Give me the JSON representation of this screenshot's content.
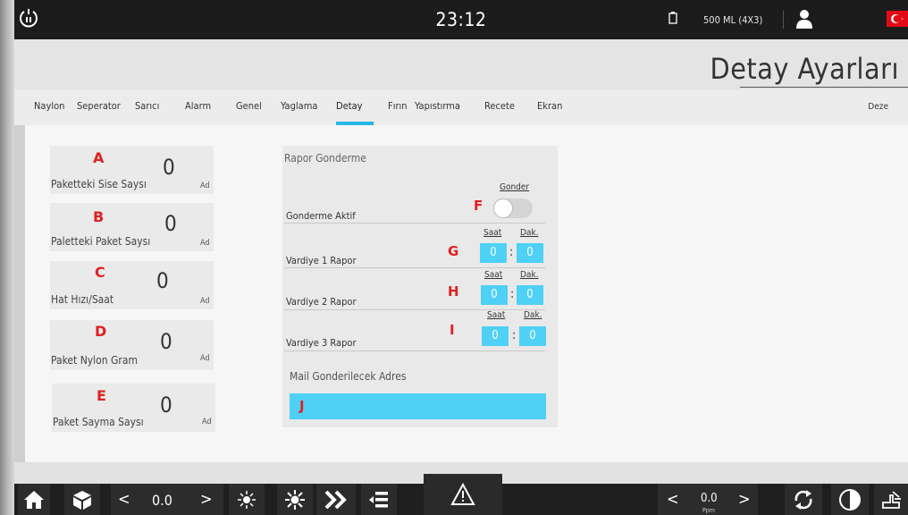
{
  "topbar": {
    "clock": "23:12",
    "product": "500 ML  (4X3)"
  },
  "header": {
    "title": "Detay Ayarları"
  },
  "tabs": [
    {
      "label": "Naylon"
    },
    {
      "label": "Seperator"
    },
    {
      "label": "Sarıcı"
    },
    {
      "label": "Alarm"
    },
    {
      "label": "Genel"
    },
    {
      "label": "Yaglama"
    },
    {
      "label": "Detay"
    },
    {
      "label": "Fırın"
    },
    {
      "label": "Yapıstırma"
    },
    {
      "label": "Recete"
    },
    {
      "label": "Ekran"
    }
  ],
  "tabs_right": "Deze",
  "active_tab": "Detay",
  "fields": [
    {
      "letter": "A",
      "label": "Paketteki Sise Saysı",
      "value": "0",
      "unit": "Ad"
    },
    {
      "letter": "B",
      "label": "Paletteki Paket Saysı",
      "value": "0",
      "unit": "Ad"
    },
    {
      "letter": "C",
      "label": "Hat Hızı/Saat",
      "value": "0",
      "unit": "Ad"
    },
    {
      "letter": "D",
      "label": "Paket Nylon Gram",
      "value": "0",
      "unit": "Ad"
    },
    {
      "letter": "E",
      "label": "Paket Sayma Saysı",
      "value": "0",
      "unit": "Ad"
    }
  ],
  "report": {
    "title": "Rapor Gonderme",
    "send_header": "Gonder",
    "send_label": "Gonderme Aktif",
    "send_mark": "F",
    "hour_label": "Saat",
    "minute_label": "Dak.",
    "shifts": [
      {
        "label": "Vardiye 1 Rapor",
        "mark": "G",
        "hour": "0",
        "minute": "0"
      },
      {
        "label": "Vardiye 2 Rapor",
        "mark": "H",
        "hour": "0",
        "minute": "0"
      },
      {
        "label": "Vardiye 3 Rapor",
        "mark": "I",
        "hour": "0",
        "minute": "0"
      }
    ],
    "colon": ":",
    "mail_label": "Mail Gonderilecek Adres",
    "mail_mark": "J",
    "mail_value": ""
  },
  "bottombar": {
    "left_value": "0.0",
    "right_value": "0.0",
    "right_unit": "Ppm",
    "prev": "<",
    "next": ">"
  },
  "colors": {
    "accent": "#29b6e8",
    "input_fill": "#4fd0f5",
    "marker_red": "#e02020"
  }
}
